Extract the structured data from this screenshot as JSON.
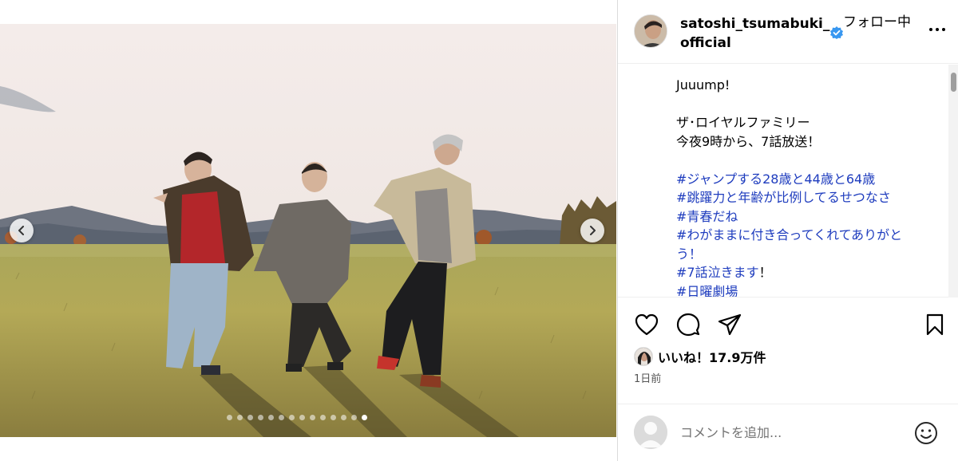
{
  "post": {
    "username": "satoshi_tsumabuki_official",
    "follow_status": "フォロー中",
    "verified": true
  },
  "caption": {
    "lines": [
      {
        "text": "Juuump!",
        "tag": false
      },
      {
        "text": "",
        "tag": false
      },
      {
        "text": "ザ･ロイヤルファミリー",
        "tag": false
      },
      {
        "text": "今夜9時から、7話放送！",
        "tag": false
      },
      {
        "text": "",
        "tag": false
      },
      {
        "text": "#ジャンプする28歳と44歳と64歳",
        "tag": true
      },
      {
        "text": "#跳躍力と年齢が比例してるせつなさ",
        "tag": true
      },
      {
        "text": "#青春だね",
        "tag": true
      },
      {
        "text": "#わがままに付き合ってくれてありがと",
        "tag": true
      },
      {
        "text": "う！",
        "tag": true
      },
      {
        "text": "#7話泣きます",
        "tag": true,
        "suffix": "！"
      },
      {
        "text": "#日曜劇場",
        "tag": true
      }
    ]
  },
  "engagement": {
    "likes": "いいね！17.9万件",
    "time": "1日前"
  },
  "comment": {
    "placeholder": "コメントを追加..."
  },
  "carousel": {
    "total": 14,
    "active_index": 13
  },
  "icons": {
    "prev": "chevron-left-icon",
    "next": "chevron-right-icon",
    "like": "heart-icon",
    "comment": "comment-icon",
    "share": "send-icon",
    "save": "bookmark-icon",
    "more": "more-icon",
    "emoji": "emoji-icon",
    "verified": "verified-badge-icon"
  },
  "colors": {
    "hashtag": "#1e3cbe",
    "verified": "#3897f0"
  }
}
